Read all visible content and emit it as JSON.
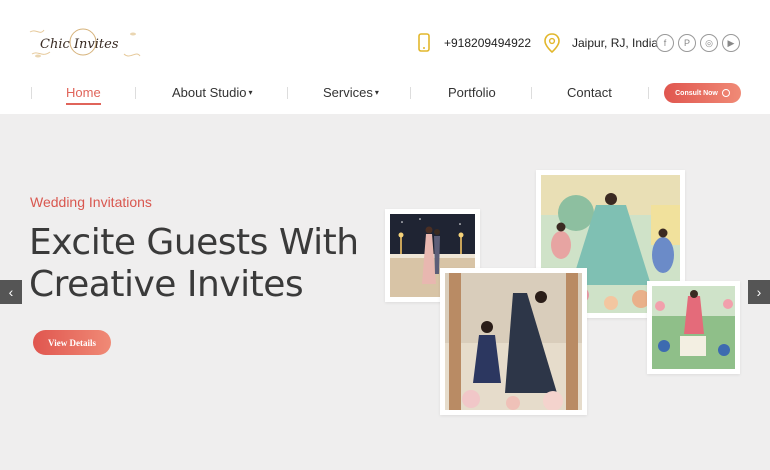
{
  "brand": {
    "logo_text": "Chic Invites"
  },
  "header": {
    "phone": "+918209494922",
    "location": "Jaipur, RJ, India",
    "socials": [
      {
        "icon": "facebook-icon",
        "glyph": "f"
      },
      {
        "icon": "pinterest-icon",
        "glyph": "P"
      },
      {
        "icon": "instagram-icon",
        "glyph": "◎"
      },
      {
        "icon": "youtube-icon",
        "glyph": "▶"
      }
    ]
  },
  "nav": {
    "items": [
      {
        "label": "Home",
        "active": true
      },
      {
        "label": "About Studio",
        "dropdown": true
      },
      {
        "label": "Services",
        "dropdown": true
      },
      {
        "label": "Portfolio"
      },
      {
        "label": "Contact"
      }
    ],
    "cta": "Consult Now"
  },
  "hero": {
    "subtitle": "Wedding Invitations",
    "headline_line1": "Excite Guests With",
    "headline_line2": "Creative Invites",
    "button": "View Details",
    "prev_arrow": "‹",
    "next_arrow": "›"
  },
  "colors": {
    "accent": "#e0645a",
    "hero_bg": "#efeeee"
  }
}
